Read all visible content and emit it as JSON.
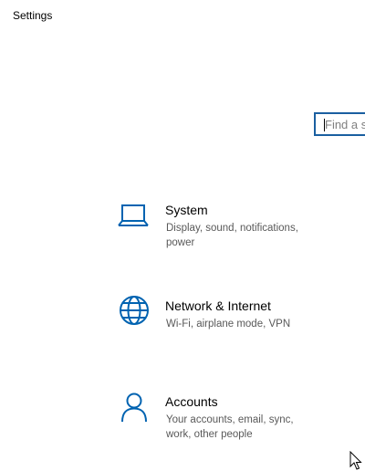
{
  "window": {
    "title": "Settings"
  },
  "search": {
    "placeholder": "Find a setting",
    "value": ""
  },
  "categories": [
    {
      "title": "System",
      "description": "Display, sound, notifications, power",
      "icon": "laptop-icon"
    },
    {
      "title": "Network & Internet",
      "description": "Wi-Fi, airplane mode, VPN",
      "icon": "globe-icon"
    },
    {
      "title": "Accounts",
      "description": "Your accounts, email, sync, work, other people",
      "icon": "person-icon"
    }
  ],
  "colors": {
    "accent": "#0063b1",
    "search_border": "#1a5fa0",
    "description_text": "#595959"
  }
}
